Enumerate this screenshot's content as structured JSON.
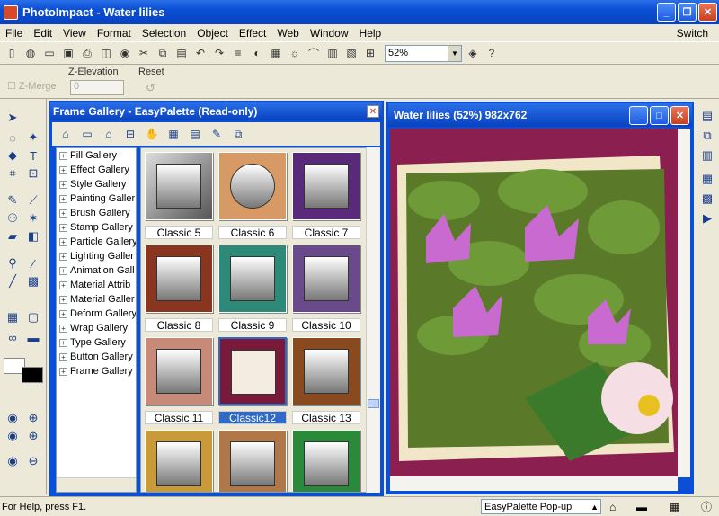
{
  "app": {
    "title": "PhotoImpact - Water lilies"
  },
  "menu": [
    "File",
    "Edit",
    "View",
    "Format",
    "Selection",
    "Object",
    "Effect",
    "Web",
    "Window",
    "Help"
  ],
  "menu_right": "Switch",
  "toolbar": {
    "zoom": "52%"
  },
  "attributes": {
    "z_elevation_label": "Z-Elevation",
    "reset_label": "Reset",
    "zmerge_label": "Z-Merge",
    "z_value": "0"
  },
  "gallery": {
    "title": "Frame Gallery - EasyPalette (Read-only)",
    "tree": [
      "Fill Gallery",
      "Effect Gallery",
      "Style Gallery",
      "Painting Galler",
      "Brush Gallery",
      "Stamp Gallery",
      "Particle Gallery",
      "Lighting Galler",
      "Animation Gall",
      "Material Attrib",
      "Material Galler",
      "Deform Gallery",
      "Wrap Gallery",
      "Type Gallery",
      "Button Gallery",
      "Frame Gallery"
    ],
    "thumbs": [
      "Classic 5",
      "Classic 6",
      "Classic 7",
      "Classic 8",
      "Classic 9",
      "Classic 10",
      "Classic 11",
      "Classic12",
      "Classic 13"
    ],
    "selected": "Classic12"
  },
  "image_window": {
    "title": "Water lilies (52%) 982x762"
  },
  "status": {
    "help": "For Help, press F1.",
    "easypalette": "EasyPalette Pop-up"
  }
}
